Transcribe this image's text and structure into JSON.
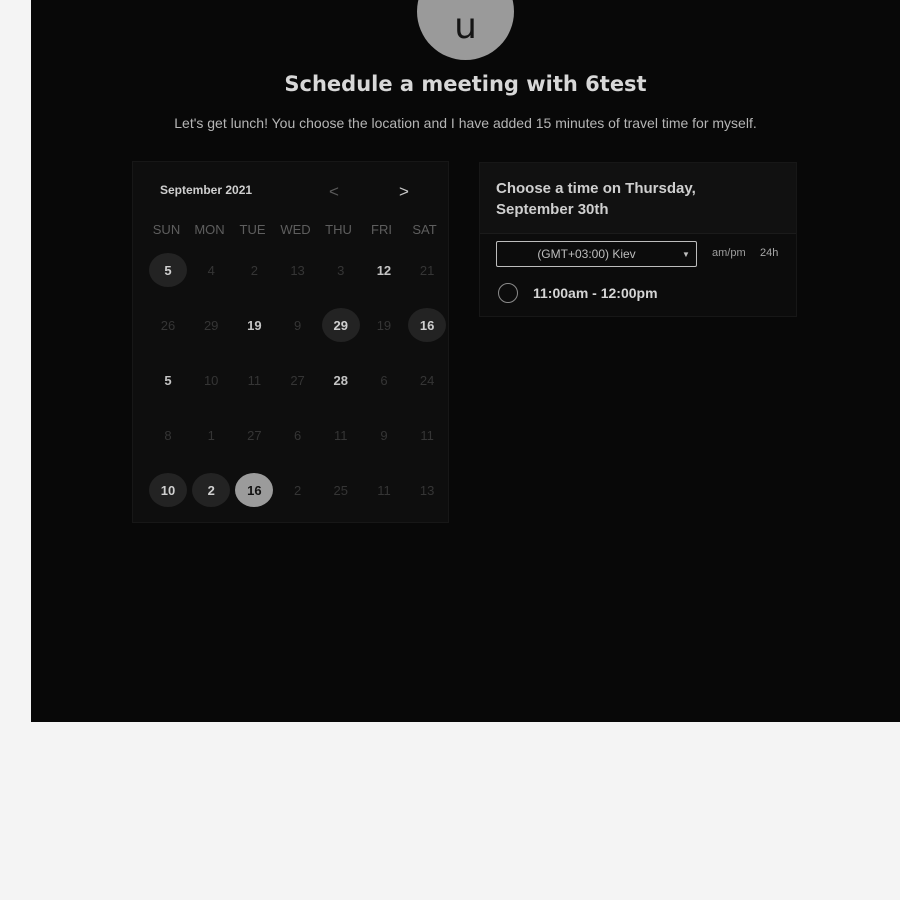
{
  "avatar": {
    "initial": "u"
  },
  "header": {
    "title": "Schedule a meeting with 6test",
    "subtitle": "Let's get lunch! You choose the location and I have added 15 minutes of travel time for myself."
  },
  "calendar": {
    "month_label": "September 2021",
    "prev_icon": "chevron-left-icon",
    "next_icon": "chevron-right-icon",
    "prev_glyph": "<",
    "next_glyph": ">",
    "weekdays": [
      "SUN",
      "MON",
      "TUE",
      "WED",
      "THU",
      "FRI",
      "SAT"
    ],
    "weeks": [
      [
        {
          "d": "5",
          "s": "avail"
        },
        {
          "d": "4",
          "s": "dim"
        },
        {
          "d": "2",
          "s": "dim"
        },
        {
          "d": "13",
          "s": "dim"
        },
        {
          "d": "3",
          "s": "dim"
        },
        {
          "d": "12",
          "s": "bold"
        },
        {
          "d": "21",
          "s": "dim"
        }
      ],
      [
        {
          "d": "26",
          "s": "dim"
        },
        {
          "d": "29",
          "s": "dim"
        },
        {
          "d": "19",
          "s": "bold"
        },
        {
          "d": "9",
          "s": "dim"
        },
        {
          "d": "29",
          "s": "avail"
        },
        {
          "d": "19",
          "s": "dim"
        },
        {
          "d": "16",
          "s": "avail"
        }
      ],
      [
        {
          "d": "5",
          "s": "bold"
        },
        {
          "d": "10",
          "s": "dim"
        },
        {
          "d": "11",
          "s": "dim"
        },
        {
          "d": "27",
          "s": "dim"
        },
        {
          "d": "28",
          "s": "bold"
        },
        {
          "d": "6",
          "s": "dim"
        },
        {
          "d": "24",
          "s": "dim"
        }
      ],
      [
        {
          "d": "8",
          "s": "dim"
        },
        {
          "d": "1",
          "s": "dim"
        },
        {
          "d": "27",
          "s": "dim"
        },
        {
          "d": "6",
          "s": "dim"
        },
        {
          "d": "11",
          "s": "dim"
        },
        {
          "d": "9",
          "s": "dim"
        },
        {
          "d": "11",
          "s": "dim"
        }
      ],
      [
        {
          "d": "10",
          "s": "avail"
        },
        {
          "d": "2",
          "s": "avail"
        },
        {
          "d": "16",
          "s": "selected"
        },
        {
          "d": "2",
          "s": "dim"
        },
        {
          "d": "25",
          "s": "dim"
        },
        {
          "d": "11",
          "s": "dim"
        },
        {
          "d": "13",
          "s": "dim"
        }
      ]
    ]
  },
  "times": {
    "title": "Choose a time on Thursday, September 30th",
    "timezone": "(GMT+03:00) Kiev",
    "timezone_caret_icon": "caret-down-icon",
    "format_ampm": "am/pm",
    "format_24h": "24h",
    "slots": [
      {
        "label": "11:00am - 12:00pm"
      }
    ]
  }
}
